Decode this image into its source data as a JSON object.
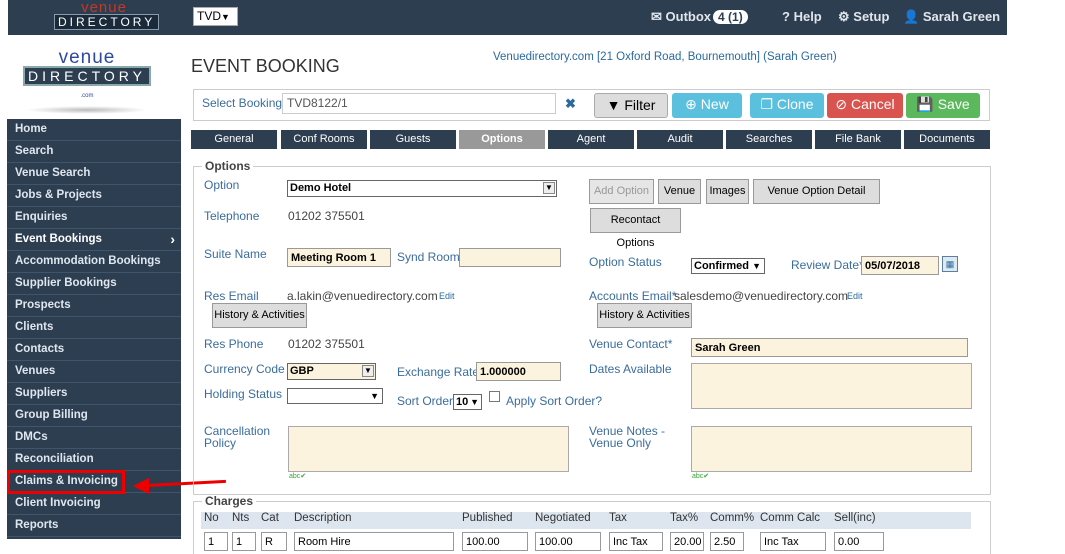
{
  "topbar": {
    "logo_line1": "venue",
    "logo_line2": "DIRECTORY",
    "company_select": "TVD",
    "outbox_label": "Outbox",
    "outbox_count": "4 (1)",
    "help_label": "Help",
    "setup_label": "Setup",
    "user_name": "Sarah Green"
  },
  "sidebar_logo": {
    "line1": "venue",
    "line2": "DIRECTORY",
    "suffix": ".com"
  },
  "sidebar": {
    "items": [
      {
        "label": "Home"
      },
      {
        "label": "Search"
      },
      {
        "label": "Venue Search"
      },
      {
        "label": "Jobs & Projects"
      },
      {
        "label": "Enquiries"
      },
      {
        "label": "Event Bookings"
      },
      {
        "label": "Accommodation Bookings"
      },
      {
        "label": "Supplier Bookings"
      },
      {
        "label": "Prospects"
      },
      {
        "label": "Clients"
      },
      {
        "label": "Contacts"
      },
      {
        "label": "Venues"
      },
      {
        "label": "Suppliers"
      },
      {
        "label": "Group Billing"
      },
      {
        "label": "DMCs"
      },
      {
        "label": "Reconciliation"
      },
      {
        "label": "Claims & Invoicing"
      },
      {
        "label": "Client Invoicing"
      },
      {
        "label": "Reports"
      }
    ],
    "active_index": 5,
    "highlighted_index": 16
  },
  "page": {
    "title": "EVENT BOOKING",
    "venue_link": "Venuedirectory.com [21 Oxford Road, Bournemouth] (Sarah Green)"
  },
  "select_bar": {
    "label": "Select Booking",
    "value": "TVD8122/1",
    "filter_label": "Filter",
    "new_label": "New",
    "clone_label": "Clone",
    "cancel_label": "Cancel",
    "save_label": "Save"
  },
  "tabs": [
    {
      "label": "General"
    },
    {
      "label": "Conf Rooms"
    },
    {
      "label": "Guests"
    },
    {
      "label": "Options"
    },
    {
      "label": "Agent"
    },
    {
      "label": "Audit"
    },
    {
      "label": "Searches"
    },
    {
      "label": "File Bank"
    },
    {
      "label": "Documents"
    }
  ],
  "options": {
    "legend": "Options",
    "option_label": "Option",
    "option_value": "Demo Hotel",
    "add_option_label": "Add Option",
    "venue_btn": "Venue",
    "images_btn": "Images",
    "venue_option_detail_btn": "Venue Option Detail",
    "telephone_label": "Telephone",
    "telephone_value": "01202 375501",
    "recontact_label": "Recontact Options",
    "suite_label": "Suite Name",
    "suite_value": "Meeting Room 1",
    "synd_label": "Synd Room",
    "synd_value": "",
    "option_status_label": "Option Status",
    "option_status_value": "Confirmed",
    "review_date_label": "Review Date*",
    "review_date_value": "05/07/2018",
    "res_email_label": "Res Email",
    "res_email_value": "a.lakin@venuedirectory.com",
    "edit_label": "Edit",
    "history_label": "History & Activities",
    "accounts_email_label": "Accounts Email*",
    "accounts_email_value": "salesdemo@venuedirectory.com",
    "res_phone_label": "Res Phone",
    "res_phone_value": "01202 375501",
    "venue_contact_label": "Venue Contact*",
    "venue_contact_value": "Sarah Green",
    "currency_label": "Currency Code",
    "currency_value": "GBP",
    "exchange_label": "Exchange Rate",
    "exchange_value": "1.000000",
    "dates_available_label": "Dates Available",
    "holding_label": "Holding Status",
    "holding_value": "",
    "sort_order_label": "Sort Order",
    "sort_order_value": "10",
    "apply_sort_label": "Apply Sort Order?",
    "cancellation_label_1": "Cancellation",
    "cancellation_label_2": "Policy",
    "venue_notes_label_1": "Venue Notes -",
    "venue_notes_label_2": "Venue Only",
    "spell": "abc"
  },
  "charges": {
    "legend": "Charges",
    "columns": [
      "No",
      "Nts",
      "Cat",
      "Description",
      "Published",
      "Negotiated",
      "Tax",
      "Tax%",
      "Comm%",
      "Comm Calc",
      "Sell(inc)"
    ],
    "first_row": {
      "no": "1",
      "nts": "1",
      "cat": "R",
      "description": "Room Hire",
      "published": "100.00",
      "negotiated": "100.00",
      "tax": "Inc Tax",
      "tax_pct": "20.00",
      "comm_pct": "2.50",
      "comm_calc": "Inc Tax",
      "sell": "0.00"
    }
  },
  "colors": {
    "navy": "#2c3e50",
    "accent_blue": "#5bc0de",
    "danger": "#d9534f",
    "success": "#5cb85c",
    "highlight_red": "#ee0000"
  }
}
